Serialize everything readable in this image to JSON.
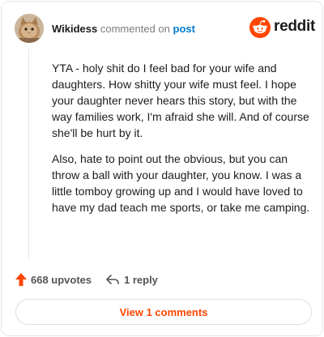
{
  "comment": {
    "username": "Wikidess",
    "action_text": "commented on",
    "link_text": "post",
    "paragraphs": [
      "YTA - holy shit do I feel bad for your wife and daughters. How shitty your wife must feel. I hope your daughter never hears this story, but with the way families work, I'm afraid she will. And of course she'll be hurt by it.",
      "Also, hate to point out the obvious, but you can throw a ball with your daughter, you know. I was a little tomboy growing up and I would have loved to have my dad teach me sports, or take me camping."
    ]
  },
  "brand": {
    "name": "reddit",
    "color": "#ff4500"
  },
  "actions": {
    "upvotes": "668 upvotes",
    "replies": "1 reply"
  },
  "footer": {
    "view_comments": "View 1 comments"
  },
  "icons": {
    "avatar": "cat-avatar",
    "logo": "reddit-snoo-icon",
    "upvote": "upvote-arrow-icon",
    "reply": "reply-arrow-icon"
  }
}
